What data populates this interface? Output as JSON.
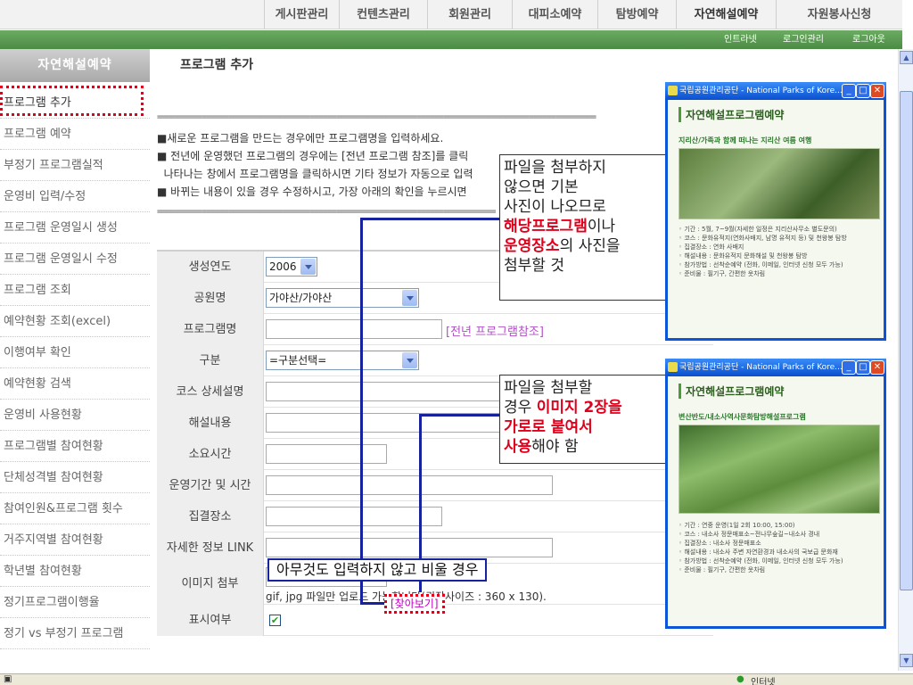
{
  "topnav": {
    "tabs": [
      "게시판관리",
      "컨텐츠관리",
      "회원관리",
      "대피소예약",
      "탐방예약",
      "자연해설예약",
      "자원봉사신청"
    ]
  },
  "greenbar": {
    "links": [
      "인트라넷",
      "로그인관리",
      "로그아웃"
    ]
  },
  "sidebar": {
    "heading": "자연해설예약",
    "items": [
      "프로그램 추가",
      "프로그램 예약",
      "부정기 프로그램실적",
      "운영비 입력/수정",
      "프로그램 운영일시 생성",
      "프로그램 운영일시 수정",
      "프로그램 조회",
      "예약현황 조회(excel)",
      "이행여부 확인",
      "예약현황 검색",
      "운영비 사용현황",
      "프로그램별 참여현황",
      "단체성격별 참여현황",
      "참여인원&프로그램 횟수",
      "거주지역별 참여현황",
      "학년별 참여현황",
      "정기프로그램이행율",
      "정기 vs 부정기 프로그램"
    ]
  },
  "main": {
    "title": "프로그램 추가",
    "divider": "==================================================================================================",
    "notices": [
      "■새로운 프로그램을 만드는 경우에만 프로그램명을 입력하세요.",
      "■ 전년에 운영했던 프로그램의 경우에는 [전년 프로그램 참조]를 클릭",
      "  나타나는 창에서 프로그램명을 클릭하시면 기타 정보가 자동으로 입력",
      "■ 바뀌는 내용이 있을 경우 수정하시고, 가장 아래의 확인을 누르시면"
    ]
  },
  "form": {
    "labels": {
      "year": "생성연도",
      "park": "공원명",
      "program": "프로그램명",
      "category": "구분",
      "course": "코스 상세설명",
      "content": "해설내용",
      "duration": "소요시간",
      "period": "운영기간 및 시간",
      "meeting": "집결장소",
      "link": "자세한 정보 LINK",
      "image": "이미지 첨부",
      "display": "표시여부"
    },
    "values": {
      "year": "2006",
      "park": "가야산/가야산",
      "category": "=구분선택="
    },
    "prev_program_link": "[전년 프로그램참조]",
    "find_button": "[찾아보기]",
    "upload_hint": "gif, jpg 파일만 업로드 가능합니다(권장사이즈 : 360 x 130).",
    "display_checked": "✔"
  },
  "annotations": {
    "callout1": {
      "t1": "파일을 첨부하지",
      "t2": "않으면 기본",
      "t3": "사진이 나오므로",
      "t4r": "해당프로그램",
      "t4": "이나",
      "t5r": "운영장소",
      "t5": "의 사진을",
      "t6": "첨부할 것"
    },
    "callout2": {
      "t1": "파일을 첨부할",
      "t2a": "경우 ",
      "t2r": "이미지 2장을",
      "t3r": "가로로 붙여서",
      "t4r": "사용",
      "t4": "해야 함"
    },
    "link_note": "아무것도 입력하지 않고 비울 경우"
  },
  "popup1": {
    "window_title": "국립공원관리공단 - National Parks of Kore...",
    "title": "자연해설프로그램예약",
    "subtitle": "지리산/가족과 함께 떠나는 지리산 여름 여행",
    "info": [
      "◦ 기간    : 5월, 7~9월(자세한 일정은 지리산사무소 별도문의)",
      "◦ 코스    : 문화유적지(연화사배지, 남명 유적지 등) 및 천왕봉 탐방",
      "◦ 집결장소 : 연화 사배지",
      "◦ 해설내용 : 문화유적지 문화해설 및 천왕봉 탐방",
      "◦ 참가방법 : 선착순예약 (전화, 이메일, 인터넷 신청 모두 가능)",
      "◦ 준비물  : 필기구, 간편한 옷차림"
    ]
  },
  "popup2": {
    "window_title": "국립공원관리공단 - National Parks of Kore...",
    "title": "자연해설프로그램예약",
    "subtitle": "변산반도/내소사역사문화탐방해설프로그램",
    "info": [
      "◦ 기간    : 연중 운영(1일 2회 10:00, 15:00)",
      "◦ 코스    : 내소사 정문매표소~전나무숲길~내소사 경내",
      "◦ 집결장소 : 내소사 정문매표소",
      "◦ 해설내용 : 내소사 주변 자연환경과 내소사의 국보급 문화재",
      "◦ 참가방법 : 선착순예약 (전화, 이메일, 인터넷 신청 모두 가능)",
      "◦ 준비물  : 필기구, 간편한 옷차림"
    ]
  },
  "statusbar": {
    "zone": "인터넷"
  }
}
